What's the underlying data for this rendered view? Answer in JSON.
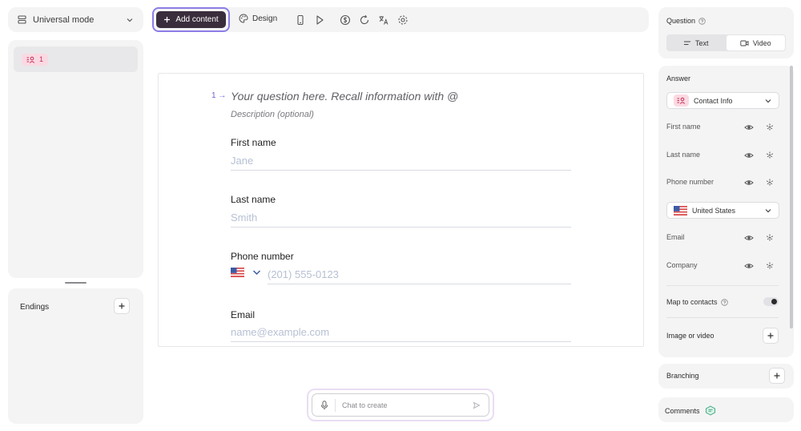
{
  "left": {
    "mode_label": "Universal mode",
    "page_badge": "1",
    "endings_title": "Endings"
  },
  "toolbar": {
    "add_content": "Add content",
    "design": "Design"
  },
  "question": {
    "number": "1",
    "title": "Your question here. Recall information with @",
    "description": "Description (optional)",
    "fields": [
      {
        "label": "First name",
        "placeholder": "Jane"
      },
      {
        "label": "Last name",
        "placeholder": "Smith"
      },
      {
        "label": "Phone number",
        "placeholder": "(201) 555-0123"
      },
      {
        "label": "Email",
        "placeholder": "name@example.com"
      }
    ]
  },
  "chat": {
    "placeholder": "Chat to create"
  },
  "right": {
    "question_title": "Question",
    "seg_text": "Text",
    "seg_video": "Video",
    "answer_title": "Answer",
    "answer_type": "Contact Info",
    "rows": [
      "First name",
      "Last name",
      "Phone number",
      "Email",
      "Company"
    ],
    "country": "United States",
    "map_to_contacts": "Map to contacts",
    "image_or_video": "Image or video",
    "branching": "Branching",
    "comments": "Comments"
  },
  "colors": {
    "accent_purple": "#8b7de6",
    "primary_button": "#3a2d3c",
    "badge_bg": "#fbd9e2",
    "badge_fg": "#c2305b"
  },
  "icons": [
    "layout-icon",
    "chevron-down-icon",
    "contact-icon",
    "plus-icon",
    "palette-icon",
    "phone-icon",
    "play-icon",
    "dollar-icon",
    "loop-icon",
    "translate-icon",
    "gear-icon",
    "microphone-icon",
    "send-icon",
    "help-icon",
    "text-lines-icon",
    "video-icon",
    "eye-icon",
    "asterisk-icon",
    "us-flag-icon",
    "comment-icon"
  ]
}
